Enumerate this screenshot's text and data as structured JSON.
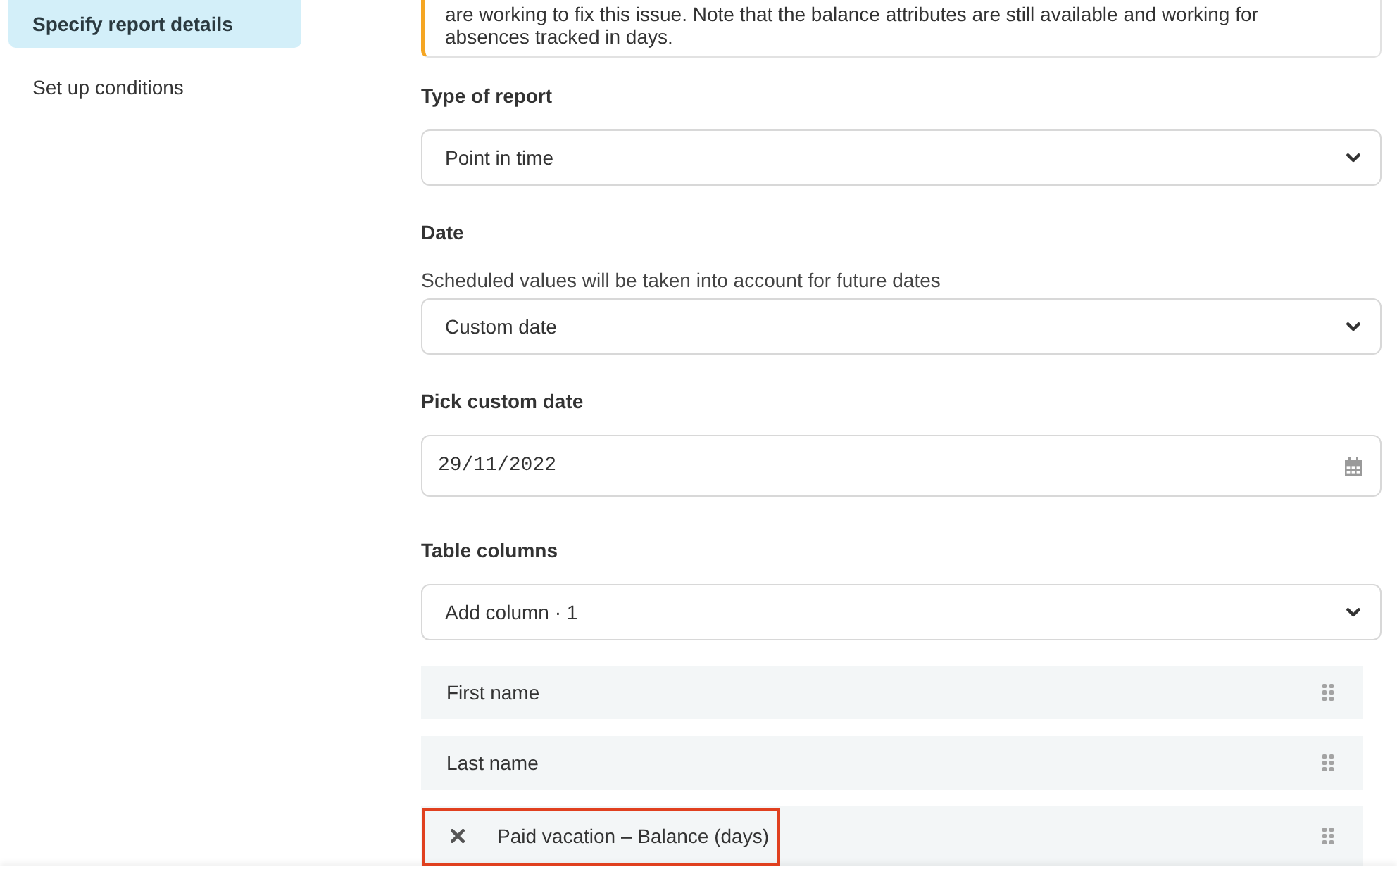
{
  "sidebar": {
    "items": [
      {
        "label": "Specify report details",
        "selected": true
      },
      {
        "label": "Set up conditions",
        "selected": false
      }
    ]
  },
  "notice": {
    "text": "are working to fix this issue. Note that the balance attributes are still available and working for absences tracked in days."
  },
  "form": {
    "fields": [
      {
        "kind": "select",
        "label": "Type of report",
        "value": "Point in time"
      },
      {
        "kind": "select",
        "label": "Date",
        "hint": "Scheduled values will be taken into account for future dates",
        "value": "Custom date"
      },
      {
        "kind": "date",
        "label": "Pick custom date",
        "value": "29/11/2022"
      },
      {
        "kind": "select",
        "label": "Table columns",
        "value": "Add column · 1"
      }
    ]
  },
  "columns": [
    {
      "label": "First name",
      "removable": false,
      "highlighted": false
    },
    {
      "label": "Last name",
      "removable": false,
      "highlighted": false
    },
    {
      "label": "Paid vacation – Balance (days)",
      "removable": true,
      "highlighted": true
    }
  ]
}
